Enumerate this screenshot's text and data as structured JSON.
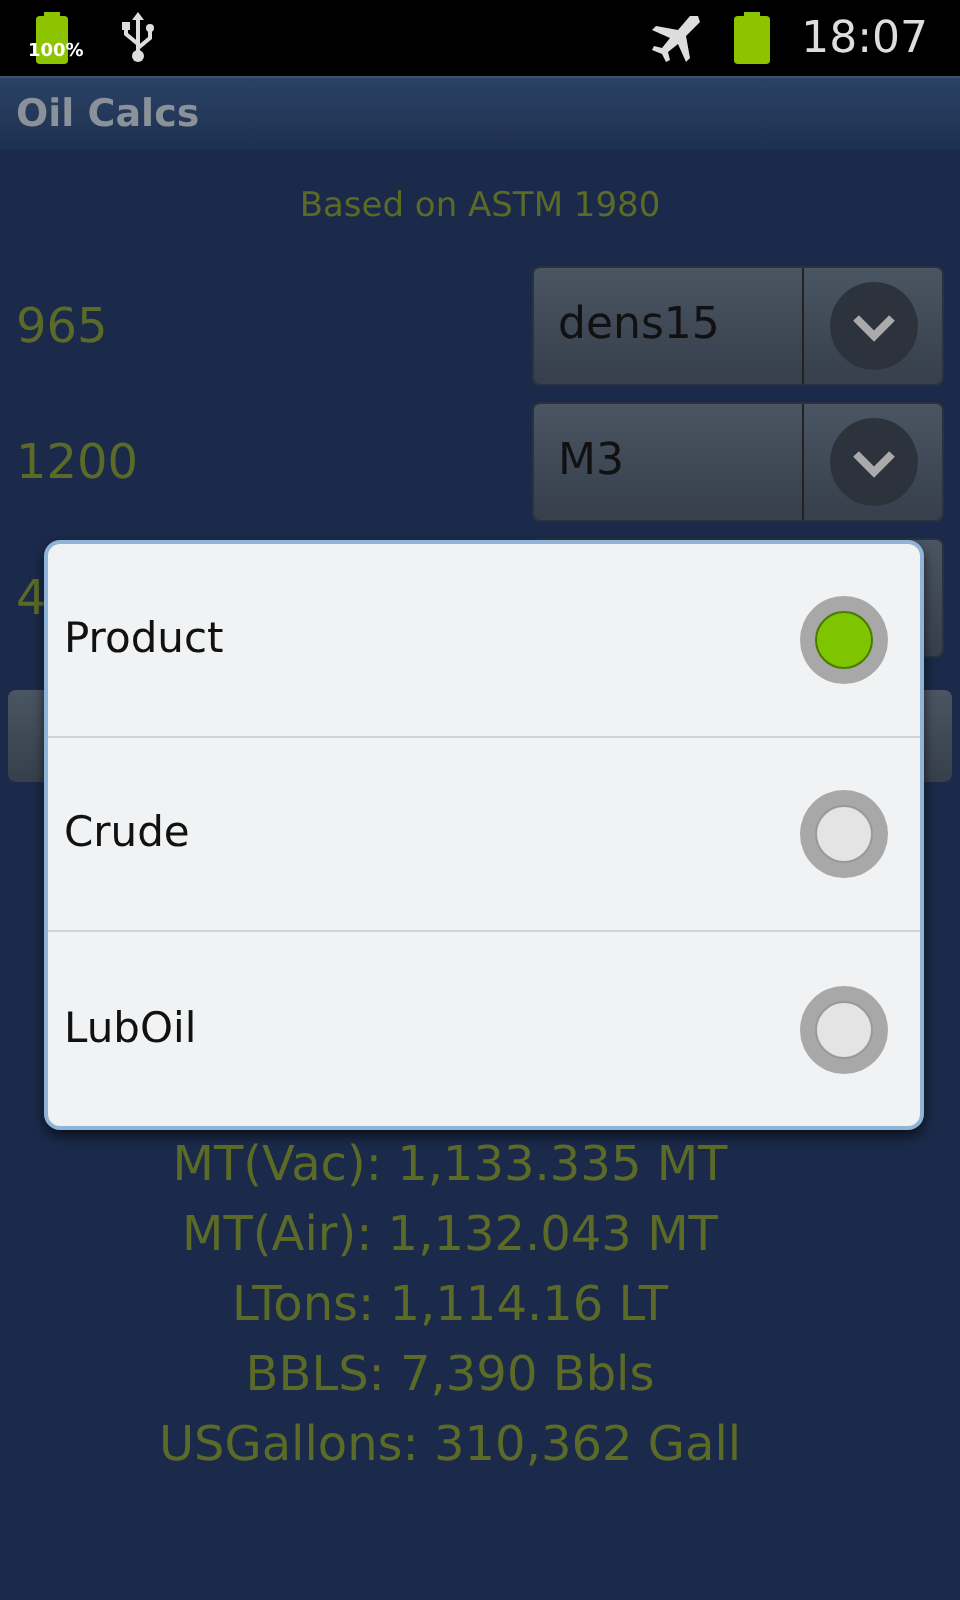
{
  "status_bar": {
    "battery_label": "100%",
    "time": "18:07"
  },
  "title": "Oil Calcs",
  "subtitle": "Based on ASTM 1980",
  "inputs": [
    {
      "value": "965",
      "spinner": "dens15"
    },
    {
      "value": "1200",
      "spinner": "M3"
    },
    {
      "value": "4"
    }
  ],
  "dialog": {
    "options": [
      {
        "label": "Product",
        "selected": true
      },
      {
        "label": "Crude",
        "selected": false
      },
      {
        "label": "LubOil",
        "selected": false
      }
    ]
  },
  "results": [
    "MT(Vac): 1,133.335 MT",
    "MT(Air): 1,132.043 MT",
    "LTons: 1,114.16 LT",
    "BBLS: 7,390 Bbls",
    "USGallons: 310,362 Gall"
  ]
}
